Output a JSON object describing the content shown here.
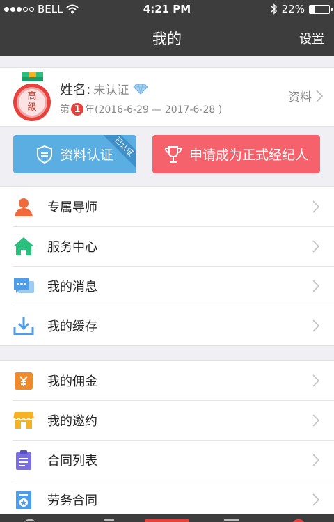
{
  "status_bar": {
    "carrier": "BELL",
    "time": "4:21 PM",
    "battery": "22%",
    "battery_level": 0.22
  },
  "nav": {
    "title": "我的",
    "settings": "设置"
  },
  "profile": {
    "badge": "高级",
    "name_label": "姓名:",
    "name_value": "未认证",
    "term_prefix": "第",
    "term_number": "1",
    "term_suffix": "年(2016-6-29 — 2017-6-28 )",
    "info_link": "资料"
  },
  "actions": {
    "auth_label": "资料认证",
    "auth_ribbon": "已认证",
    "apply_label": "申请成为正式经纪人"
  },
  "menu_group_1": [
    {
      "label": "专属导师",
      "icon": "user-icon",
      "color": "#f06a3c"
    },
    {
      "label": "服务中心",
      "icon": "home-icon",
      "color": "#2bbf7e"
    },
    {
      "label": "我的消息",
      "icon": "message-icon",
      "color": "#4d9de8"
    },
    {
      "label": "我的缓存",
      "icon": "download-icon",
      "color": "#4d9de8"
    }
  ],
  "menu_group_2": [
    {
      "label": "我的佣金",
      "icon": "wallet-icon",
      "color": "#f08a2a"
    },
    {
      "label": "我的邀约",
      "icon": "store-icon",
      "color": "#f4b324"
    },
    {
      "label": "合同列表",
      "icon": "clipboard-icon",
      "color": "#7a6ee0"
    },
    {
      "label": "劳务合同",
      "icon": "contract-icon",
      "color": "#4d9de8"
    }
  ],
  "colors": {
    "header_bg": "#3d3d3d",
    "auth_button": "#5aaee2",
    "apply_button": "#f5626c",
    "accent_red": "#e8413c"
  }
}
